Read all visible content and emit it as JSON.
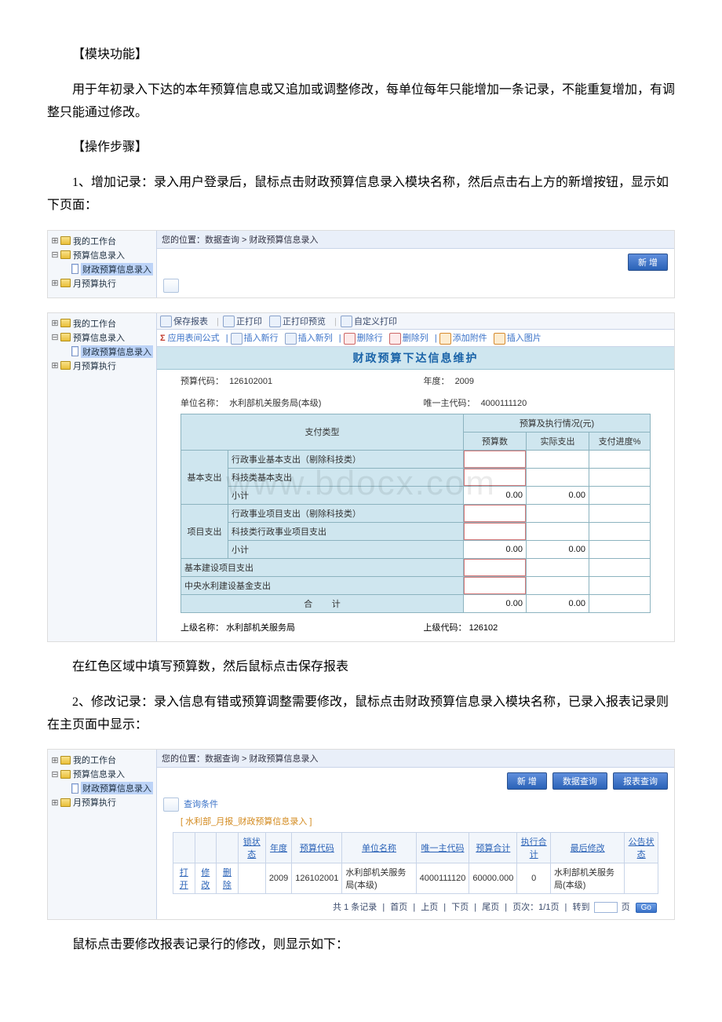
{
  "doc": {
    "h_module": "【模块功能】",
    "p_module": "用于年初录入下达的本年预算信息或又追加或调整修改，每单位每年只能增加一条记录，不能重复增加，有调整只能通过修改。",
    "h_steps": "【操作步骤】",
    "p_step1": "1、增加记录：录入用户登录后，鼠标点击财政预算信息录入模块名称，然后点击右上方的新增按钮，显示如下页面：",
    "p_fill": "在红色区域中填写预算数，然后鼠标点击保存报表",
    "p_step2": "2、修改记录：录入信息有错或预算调整需要修改，鼠标点击财政预算信息录入模块名称，已录入报表记录则在主页面中显示：",
    "p_mod": "鼠标点击要修改报表记录行的修改，则显示如下："
  },
  "tree": {
    "my_workbench": "我的工作台",
    "budget_entry": "预算信息录入",
    "fiscal_entry": "财政预算信息录入",
    "month_exec": "月预算执行"
  },
  "fig1": {
    "crumb": "您的位置：数据查询 > 财政预算信息录入",
    "new_btn": "新 增"
  },
  "fig2": {
    "toolbar": {
      "save": "保存报表",
      "print": "正打印",
      "preview": "正打印预览",
      "custom_print": "自定义打印",
      "formula": "应用表间公式",
      "ins_row": "插入新行",
      "ins_col": "插入新列",
      "del_row": "删除行",
      "del_col": "删除列",
      "add_attach": "添加附件",
      "ins_img": "插入图片"
    },
    "title": "财政预算下达信息维护",
    "fields": {
      "budget_code_lbl": "预算代码：",
      "budget_code": "126102001",
      "year_lbl": "年度：",
      "year": "2009",
      "unit_name_lbl": "单位名称：",
      "unit_name": "水利部机关服务局(本级)",
      "main_code_lbl": "唯一主代码：",
      "main_code": "4000111120",
      "sup_name_lbl": "上级名称：",
      "sup_name": "水利部机关服务局",
      "sup_code_lbl": "上级代码：",
      "sup_code": "126102"
    },
    "headers": {
      "pay_type": "支付类型",
      "exec_group": "预算及执行情况(元)",
      "budget_num": "预算数",
      "actual_pay": "实际支出",
      "progress": "支付进度%"
    },
    "rows": {
      "basic": "基本支出",
      "basic_r1": "行政事业基本支出（剔除科技类）",
      "basic_r2": "科技类基本支出",
      "subtotal": "小计",
      "proj": "项目支出",
      "proj_r1": "行政事业项目支出（剔除科技类）",
      "proj_r2": "科技类行政事业项目支出",
      "cap": "基本建设项目支出",
      "central": "中央水利建设基金支出",
      "total_lbl": "合",
      "total_lbl2": "计",
      "zero": "0.00"
    }
  },
  "fig3": {
    "crumb": "您的位置：数据查询 > 财政预算信息录入",
    "buttons": {
      "new": "新 增",
      "data_q": "数据查询",
      "rpt_q": "报表查询"
    },
    "search_cond": "查询条件",
    "dataset": "[ 水利部_月报_财政预算信息录入 ]",
    "headers": {
      "open": "",
      "edit": "",
      "del": "",
      "lock": "锁状态",
      "year": "年度",
      "budget_code": "预算代码",
      "unit_name": "单位名称",
      "main_code": "唯一主代码",
      "total": "预算合计",
      "exec_total": "执行合计",
      "last_mod": "最后修改",
      "pub": "公告状态"
    },
    "row": {
      "open": "打开",
      "edit": "修改",
      "del": "删除",
      "year": "2009",
      "budget_code": "126102001",
      "unit_name": "水利部机关服务局(本级)",
      "main_code": "4000111120",
      "total": "60000.000",
      "exec_total": "0",
      "last_mod": "水利部机关服务局(本级)"
    },
    "pager": {
      "count": "共 1 条记录",
      "first": "首页",
      "prev": "上页",
      "next": "下页",
      "last": "尾页",
      "page_pos": "页次：1/1页",
      "jump": "转到",
      "page_suffix": "页",
      "go": "Go"
    }
  },
  "watermark": "www.bdocx.com"
}
